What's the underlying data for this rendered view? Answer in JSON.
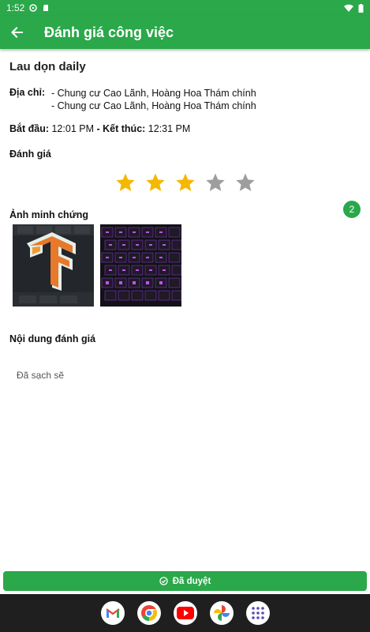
{
  "status_bar": {
    "time": "1:52"
  },
  "app_bar": {
    "title": "Đánh giá công việc"
  },
  "job": {
    "title": "Lau dọn daily",
    "address_label": "Địa chỉ:",
    "addresses": [
      "- Chung cư Cao Lãnh, Hoàng Hoa Thám chính",
      "- Chung cư Cao Lãnh, Hoàng Hoa Thám chính"
    ],
    "start_label": "Bắt đầu:",
    "start_time": "12:01 PM",
    "separator": "-",
    "end_label": "Kết thúc:",
    "end_time": "12:31 PM"
  },
  "rating": {
    "label": "Đánh giá",
    "value": 3,
    "max": 5,
    "filled_color": "#f5b800",
    "empty_color": "#9e9e9e"
  },
  "proof": {
    "label": "Ảnh minh chứng",
    "count": "2"
  },
  "review": {
    "label": "Nội dung đánh giá",
    "text": "Đã sạch sẽ"
  },
  "approve_button": {
    "label": "Đã duyệt"
  },
  "dock": {
    "apps": [
      "gmail-icon",
      "chrome-icon",
      "youtube-icon",
      "photos-icon",
      "app-drawer-icon"
    ]
  },
  "colors": {
    "primary": "#2aa84a"
  }
}
